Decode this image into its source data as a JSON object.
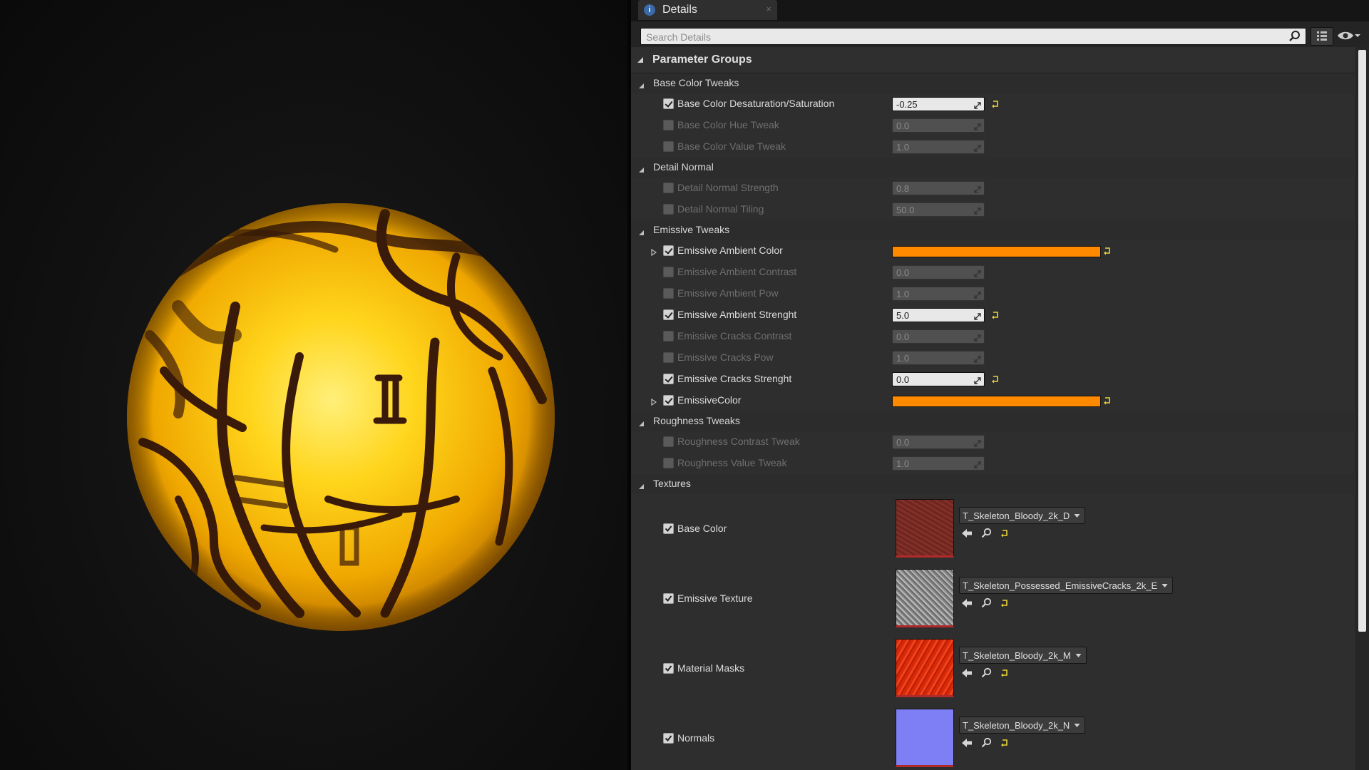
{
  "panel": {
    "tab_title": "Details",
    "search_placeholder": "Search Details"
  },
  "header": {
    "title": "Parameter Groups"
  },
  "groups": [
    {
      "name": "Base Color Tweaks",
      "params": [
        {
          "label": "Base Color Desaturation/Saturation",
          "checked": true,
          "value": "-0.25",
          "modified": true
        },
        {
          "label": "Base Color Hue Tweak",
          "checked": false,
          "value": "0.0"
        },
        {
          "label": "Base Color Value Tweak",
          "checked": false,
          "value": "1.0"
        }
      ]
    },
    {
      "name": "Detail Normal",
      "params": [
        {
          "label": "Detail Normal Strength",
          "checked": false,
          "value": "0.8"
        },
        {
          "label": "Detail Normal Tiling",
          "checked": false,
          "value": "50.0"
        }
      ]
    },
    {
      "name": "Emissive Tweaks",
      "params": [
        {
          "label": "Emissive Ambient Color",
          "checked": true,
          "color": "#ff8a00",
          "expandable": true
        },
        {
          "label": "Emissive Ambient Contrast",
          "checked": false,
          "value": "0.0"
        },
        {
          "label": "Emissive Ambient Pow",
          "checked": false,
          "value": "1.0"
        },
        {
          "label": "Emissive Ambient Strenght",
          "checked": true,
          "value": "5.0",
          "modified": true
        },
        {
          "label": "Emissive Cracks Contrast",
          "checked": false,
          "value": "0.0"
        },
        {
          "label": "Emissive Cracks Pow",
          "checked": false,
          "value": "1.0"
        },
        {
          "label": "Emissive Cracks Strenght",
          "checked": true,
          "value": "0.0",
          "modified": true
        },
        {
          "label": "EmissiveColor",
          "checked": true,
          "color": "#ff8a00",
          "expandable": true
        }
      ]
    },
    {
      "name": "Roughness Tweaks",
      "params": [
        {
          "label": "Roughness Contrast Tweak",
          "checked": false,
          "value": "0.0"
        },
        {
          "label": "Roughness Value Tweak",
          "checked": false,
          "value": "1.0"
        }
      ]
    }
  ],
  "textures": {
    "name": "Textures",
    "items": [
      {
        "label": "Base Color",
        "checked": true,
        "asset": "T_Skeleton_Bloody_2k_D",
        "thumb": "#7a2a24"
      },
      {
        "label": "Emissive Texture",
        "checked": true,
        "asset": "T_Skeleton_Possessed_EmissiveCracks_2k_E",
        "thumb": "#9a9a9a"
      },
      {
        "label": "Material Masks",
        "checked": true,
        "asset": "T_Skeleton_Bloody_2k_M",
        "thumb": "#e0300e"
      },
      {
        "label": "Normals",
        "checked": true,
        "asset": "T_Skeleton_Bloody_2k_N",
        "thumb": "#7f7ff5"
      }
    ]
  },
  "colors": {
    "accent_orange": "#ff8a00",
    "reset_arrow": "#e8d23a",
    "sphere_glow": "#ffd21a"
  },
  "icons": {
    "tab": "details-info-icon",
    "search": "search-icon",
    "view_options": "eye-icon",
    "grid": "grid-view-icon",
    "reset": "reset-to-default-icon",
    "browse": "use-selected-asset-icon",
    "find": "find-in-browser-icon"
  }
}
